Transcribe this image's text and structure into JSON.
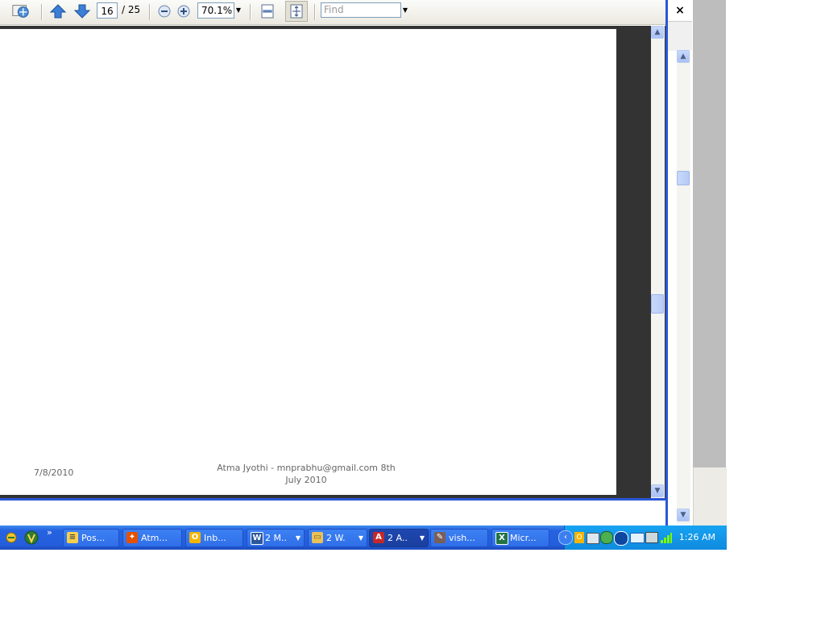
{
  "toolbar": {
    "page_current": "16",
    "page_total": "/ 25",
    "zoom": "70.1%",
    "find_placeholder": "Find"
  },
  "document": {
    "footer_date": "7/8/2010",
    "footer_line1": "Atma Jyothi - mnprabhu@gmail.com 8th",
    "footer_line2": "July 2010"
  },
  "window": {
    "close_label": "×"
  },
  "taskbar": {
    "overflow": "»",
    "tasks": [
      {
        "label": "Pos...",
        "icon": "sticky-note-icon"
      },
      {
        "label": "Atm...",
        "icon": "browser-icon"
      },
      {
        "label": "Inb...",
        "icon": "outlook-icon"
      },
      {
        "label": "2 M..",
        "icon": "word-icon"
      },
      {
        "label": "2 W.",
        "icon": "folder-icon"
      },
      {
        "label": "2 A..",
        "icon": "acrobat-icon"
      },
      {
        "label": "vish...",
        "icon": "app-icon"
      },
      {
        "label": "Micr...",
        "icon": "excel-icon"
      }
    ],
    "clock": "1:26 AM"
  },
  "colors": {
    "taskbar_blue": "#245edc",
    "tray_blue": "#0f8adf",
    "doc_background": "#333333"
  }
}
